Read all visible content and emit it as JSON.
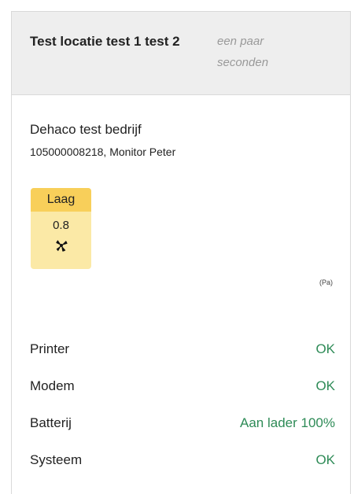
{
  "card": {
    "location_title": "Test locatie test 1 test 2",
    "time_ago": "een paar seconden",
    "company_name": "Dehaco test bedrijf",
    "device_info": "105000008218, Monitor Peter"
  },
  "pressure": {
    "level_label": "Laag",
    "value": "0.8",
    "unit": "(Pa)",
    "icon": "fan-icon",
    "level_color": "#f8cf5a",
    "tile_color": "#fbe9a6"
  },
  "status": [
    {
      "label": "Printer",
      "value": "OK"
    },
    {
      "label": "Modem",
      "value": "OK"
    },
    {
      "label": "Batterij",
      "value": "Aan lader 100%"
    },
    {
      "label": "Systeem",
      "value": "OK"
    }
  ],
  "colors": {
    "ok_green": "#2e8b57",
    "header_bg": "#eeeeee",
    "muted_text": "#999999"
  }
}
